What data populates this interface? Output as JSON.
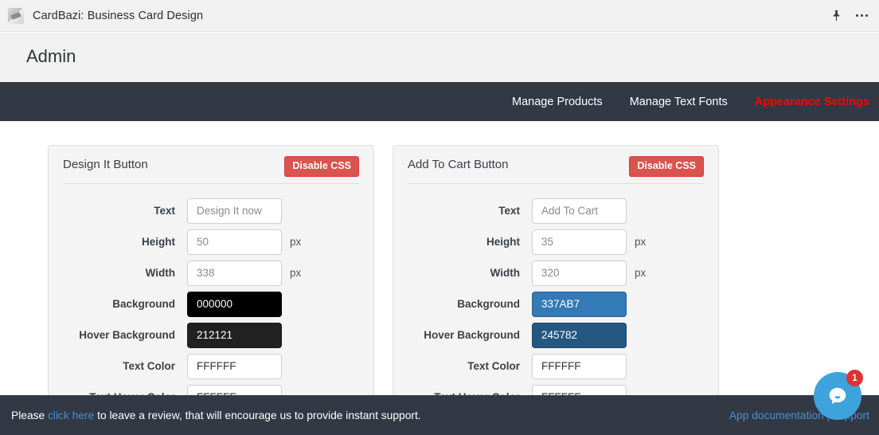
{
  "titlebar": {
    "title": "CardBazi: Business Card Design",
    "app_icon": "card-design-icon",
    "pin_icon": "pin-icon",
    "more_icon": "ellipsis-icon"
  },
  "header": {
    "title": "Admin"
  },
  "nav": {
    "items": [
      {
        "label": "Manage Products",
        "active": false
      },
      {
        "label": "Manage Text Fonts",
        "active": false
      },
      {
        "label": "Appearance Settings",
        "active": true
      }
    ],
    "active_color": "#ff0000",
    "background": "#323944"
  },
  "cards": [
    {
      "title": "Design It Button",
      "disable_button": "Disable CSS",
      "rows": [
        {
          "label": "Text",
          "value": "Design It now",
          "unit": "",
          "swatch": false,
          "bg": "#ffffff",
          "fg": "#8a8a8a"
        },
        {
          "label": "Height",
          "value": "50",
          "unit": "px",
          "swatch": false,
          "bg": "#ffffff",
          "fg": "#8a8a8a"
        },
        {
          "label": "Width",
          "value": "338",
          "unit": "px",
          "swatch": false,
          "bg": "#ffffff",
          "fg": "#8a8a8a"
        },
        {
          "label": "Background",
          "value": "000000",
          "unit": "",
          "swatch": true,
          "bg": "#000000",
          "fg": "#ffffff"
        },
        {
          "label": "Hover Background",
          "value": "212121",
          "unit": "",
          "swatch": true,
          "bg": "#212121",
          "fg": "#ffffff"
        },
        {
          "label": "Text Color",
          "value": "FFFFFF",
          "unit": "",
          "swatch": true,
          "bg": "#ffffff",
          "fg": "#333333"
        },
        {
          "label": "Text Hover Color",
          "value": "FFFFFF",
          "unit": "",
          "swatch": true,
          "bg": "#ffffff",
          "fg": "#333333"
        }
      ]
    },
    {
      "title": "Add To Cart Button",
      "disable_button": "Disable CSS",
      "rows": [
        {
          "label": "Text",
          "value": "Add To Cart",
          "unit": "",
          "swatch": false,
          "bg": "#ffffff",
          "fg": "#8a8a8a"
        },
        {
          "label": "Height",
          "value": "35",
          "unit": "px",
          "swatch": false,
          "bg": "#ffffff",
          "fg": "#8a8a8a"
        },
        {
          "label": "Width",
          "value": "320",
          "unit": "px",
          "swatch": false,
          "bg": "#ffffff",
          "fg": "#8a8a8a"
        },
        {
          "label": "Background",
          "value": "337AB7",
          "unit": "",
          "swatch": true,
          "bg": "#337AB7",
          "fg": "#ffffff"
        },
        {
          "label": "Hover Background",
          "value": "245782",
          "unit": "",
          "swatch": true,
          "bg": "#245782",
          "fg": "#ffffff"
        },
        {
          "label": "Text Color",
          "value": "FFFFFF",
          "unit": "",
          "swatch": true,
          "bg": "#ffffff",
          "fg": "#333333"
        },
        {
          "label": "Text Hover Color",
          "value": "FFFFFF",
          "unit": "",
          "swatch": true,
          "bg": "#ffffff",
          "fg": "#333333"
        }
      ]
    }
  ],
  "banner": {
    "text_before": "Please ",
    "link": "click here",
    "text_after": " to leave a review, that will encourage us to provide instant support.",
    "right_link": "App documentation | support"
  },
  "chat": {
    "badge": "1",
    "icon": "chat-bubble-icon",
    "color": "#3ea2dd"
  }
}
